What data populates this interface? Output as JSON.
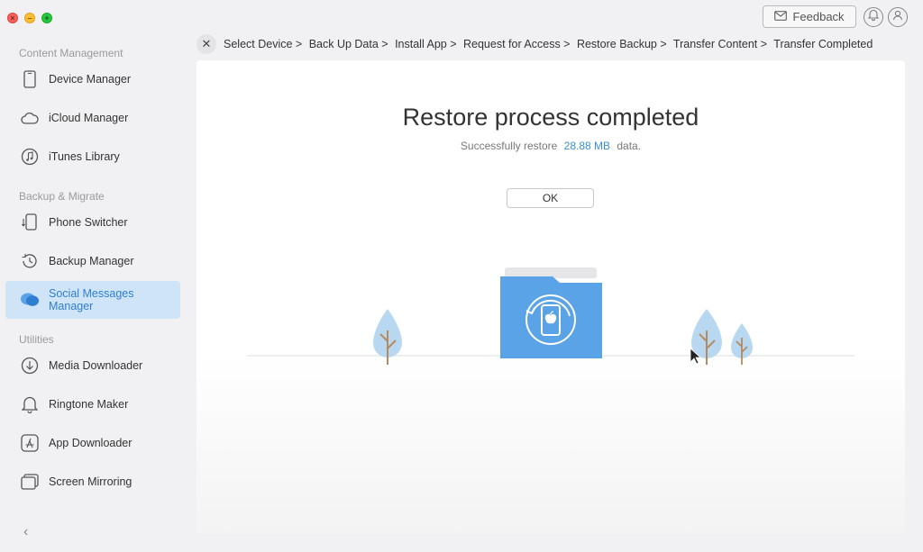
{
  "window": {
    "feedback_label": "Feedback"
  },
  "sidebar": {
    "sections": [
      {
        "title": "Content Management"
      },
      {
        "title": "Backup & Migrate"
      },
      {
        "title": "Utilities"
      }
    ],
    "items": [
      {
        "label": "Device Manager",
        "icon": "phone-icon"
      },
      {
        "label": "iCloud Manager",
        "icon": "cloud-icon"
      },
      {
        "label": "iTunes Library",
        "icon": "music-icon"
      },
      {
        "label": "Phone Switcher",
        "icon": "switch-icon"
      },
      {
        "label": "Backup Manager",
        "icon": "history-icon"
      },
      {
        "label": "Social Messages Manager",
        "icon": "chat-icon",
        "active": true
      },
      {
        "label": "Media Downloader",
        "icon": "download-icon"
      },
      {
        "label": "Ringtone Maker",
        "icon": "bell-icon"
      },
      {
        "label": "App Downloader",
        "icon": "app-store-icon"
      },
      {
        "label": "Screen Mirroring",
        "icon": "mirror-icon"
      }
    ]
  },
  "breadcrumb": {
    "steps": [
      "Select Device >",
      "Back Up Data >",
      "Install App >",
      "Request for Access >",
      "Restore Backup >",
      "Transfer Content >",
      "Transfer Completed"
    ]
  },
  "main": {
    "title": "Restore process completed",
    "sub_prefix": "Successfully restore",
    "sub_size": "28.88 MB",
    "sub_suffix": "data.",
    "ok_label": "OK"
  },
  "colors": {
    "accent": "#3a8fd6",
    "active_bg": "#cfe4f7",
    "folder": "#5aa3e6",
    "tree": "#b8d8f2"
  }
}
